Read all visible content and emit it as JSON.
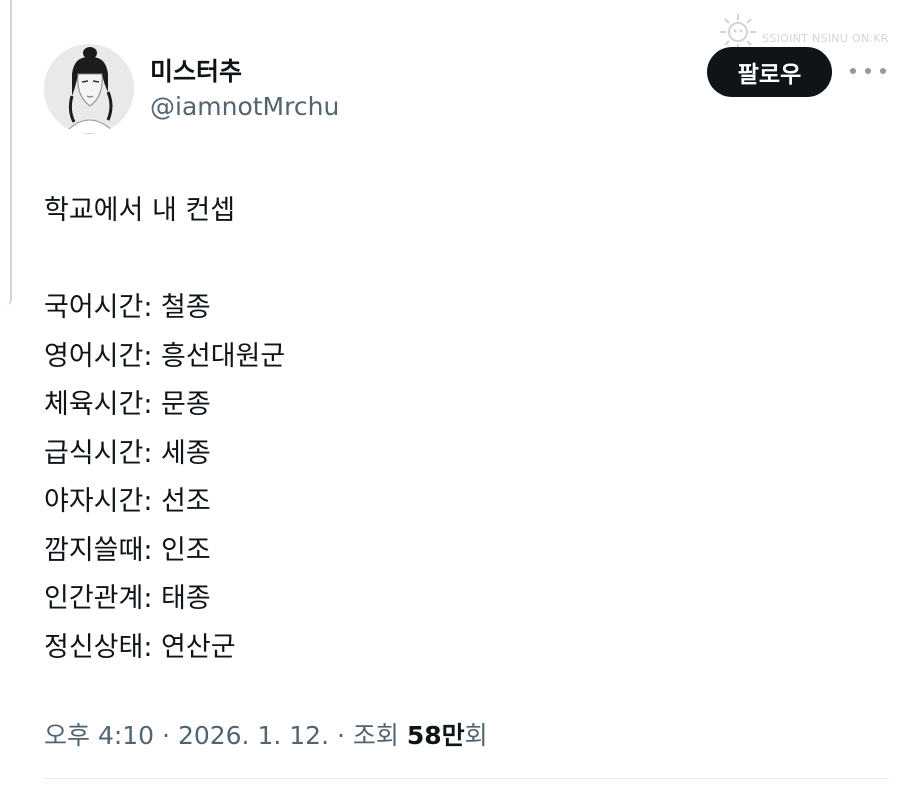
{
  "author": {
    "display_name": "미스터추",
    "handle": "@iamnotMrchu"
  },
  "follow_button": {
    "label": "팔로우"
  },
  "watermark": {
    "text": "SSIOINT NSINU ON.KR"
  },
  "tweet": {
    "intro": "학교에서 내 컨셉",
    "lines": [
      "국어시간: 철종",
      "영어시간: 흥선대원군",
      "체육시간: 문종",
      "급식시간: 세종",
      "야자시간: 선조",
      "깜지쓸때: 인조",
      "인간관계: 태종",
      "정신상태: 연산군"
    ]
  },
  "meta": {
    "time": "오후 4:10",
    "separator": " · ",
    "date": "2026. 1. 12.",
    "views_label": "조회",
    "views_count": "58만",
    "views_suffix": "회"
  },
  "icons": {
    "more": "more-horizontal-icon",
    "watermark": "sun-logo-icon"
  },
  "colors": {
    "text_primary": "#0f1419",
    "text_secondary": "#536471",
    "button_bg": "#0f1419",
    "divider": "#e6ecf0"
  }
}
